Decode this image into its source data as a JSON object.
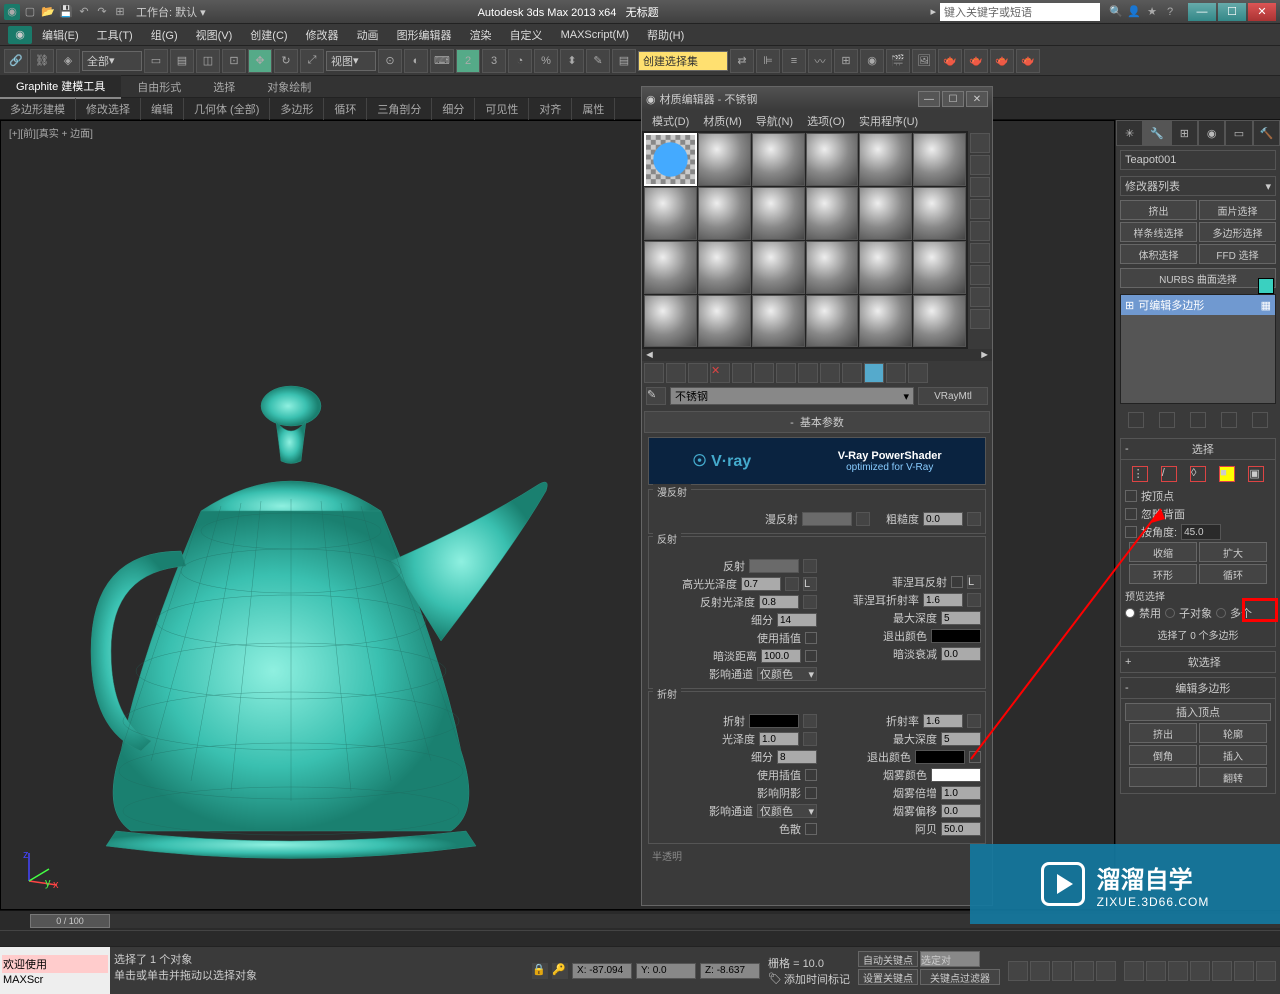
{
  "titlebar": {
    "workspace_label": "工作台: 默认",
    "app_title": "Autodesk 3ds Max  2013 x64",
    "doc_title": "无标题",
    "search_placeholder": "键入关键字或短语"
  },
  "menubar": [
    "编辑(E)",
    "工具(T)",
    "组(G)",
    "视图(V)",
    "创建(C)",
    "修改器",
    "动画",
    "图形编辑器",
    "渲染",
    "自定义",
    "MAXScript(M)",
    "帮助(H)"
  ],
  "toolbar": {
    "filter_combo": "全部",
    "view_combo": "视图",
    "selection_set": "创建选择集"
  },
  "ribbon": {
    "tabs": [
      "Graphite 建模工具",
      "自由形式",
      "选择",
      "对象绘制"
    ],
    "subtabs": [
      "多边形建模",
      "修改选择",
      "编辑",
      "几何体 (全部)",
      "多边形",
      "循环",
      "三角剖分",
      "细分",
      "可见性",
      "对齐",
      "属性"
    ]
  },
  "viewport": {
    "label": "[+][前][真实 + 边面]"
  },
  "material_editor": {
    "title": "材质编辑器 - 不锈钢",
    "menus": [
      "模式(D)",
      "材质(M)",
      "导航(N)",
      "选项(O)",
      "实用程序(U)"
    ],
    "material_name": "不锈钢",
    "material_type": "VRayMtl",
    "rollout_basic": "基本参数",
    "vray_banner_logo": "☉ V·ray",
    "vray_banner_txt1": "V-Ray PowerShader",
    "vray_banner_txt2": "optimized for V-Ray",
    "diffuse": {
      "title": "漫反射",
      "diffuse_label": "漫反射",
      "roughness_label": "粗糙度",
      "roughness_val": "0.0"
    },
    "reflect": {
      "title": "反射",
      "reflect_label": "反射",
      "l1_label": "高光光泽度",
      "l1_val": "0.7",
      "r1_label": "菲涅耳反射",
      "l2_label": "反射光泽度",
      "l2_val": "0.8",
      "r2_label": "菲涅耳折射率",
      "r2_val": "1.6",
      "l3_label": "细分",
      "l3_val": "14",
      "r3_label": "最大深度",
      "r3_val": "5",
      "l4_label": "使用插值",
      "r4_label": "退出颜色",
      "l5_label": "暗淡距离",
      "l5_val": "100.0",
      "r5_label": "暗淡衰减",
      "r5_val": "0.0",
      "l6_label": "影响通道",
      "l6_val": "仅颜色"
    },
    "refract": {
      "title": "折射",
      "l1_label": "折射",
      "r1_label": "折射率",
      "r1_val": "1.6",
      "l2_label": "光泽度",
      "l2_val": "1.0",
      "r2_label": "最大深度",
      "r2_val": "5",
      "l3_label": "细分",
      "l3_val": "8",
      "r3_label": "退出颜色",
      "l4_label": "使用插值",
      "r4_label": "烟雾颜色",
      "l5_label": "影响阴影",
      "r5_label": "烟雾倍增",
      "r5_val": "1.0",
      "l6_label": "影响通道",
      "l6_val": "仅颜色",
      "r6_label": "烟雾偏移",
      "r6_val": "0.0",
      "l7_label": "色散",
      "r7_label": "阿贝",
      "r7_val": "50.0"
    },
    "translucency": "半透明"
  },
  "cmdpanel": {
    "object_name": "Teapot001",
    "modifier_list": "修改器列表",
    "buttons": [
      "挤出",
      "面片选择",
      "样条线选择",
      "多边形选择",
      "体积选择",
      "FFD 选择"
    ],
    "nurbs": "NURBS 曲面选择",
    "stack_item": "可编辑多边形",
    "selection": {
      "header": "选择",
      "by_vertex": "按顶点",
      "ignore_backface": "忽略背面",
      "by_angle": "按角度:",
      "angle_val": "45.0",
      "shrink": "收缩",
      "grow": "扩大",
      "ring": "环形",
      "loop": "循环",
      "preview_title": "预览选择",
      "disable": "禁用",
      "subobj": "子对象",
      "multi": "多个",
      "status": "选择了 0 个多边形"
    },
    "soft_sel": "软选择",
    "edit_poly": {
      "header": "编辑多边形",
      "insert_vertex": "插入顶点",
      "b1": "挤出",
      "b2": "轮廓",
      "b3": "倒角",
      "b4": "插入",
      "b6": "翻转"
    }
  },
  "timeline": {
    "frame": "0 / 100"
  },
  "statusbar": {
    "welcome": "欢迎使用",
    "script": "MAXScr",
    "prompt1": "选择了 1 个对象",
    "prompt2": "单击或单击并拖动以选择对象",
    "x": "X: -87.094",
    "y": "Y: 0.0",
    "z": "Z: -8.637",
    "grid": "栅格 = 10.0",
    "add_time_tag": "添加时间标记",
    "auto_key": "自动关键点",
    "selected": "选定对",
    "set_key": "设置关键点",
    "key_filter": "关键点过滤器"
  },
  "watermark": {
    "big": "溜溜自学",
    "small": "ZIXUE.3D66.COM"
  }
}
